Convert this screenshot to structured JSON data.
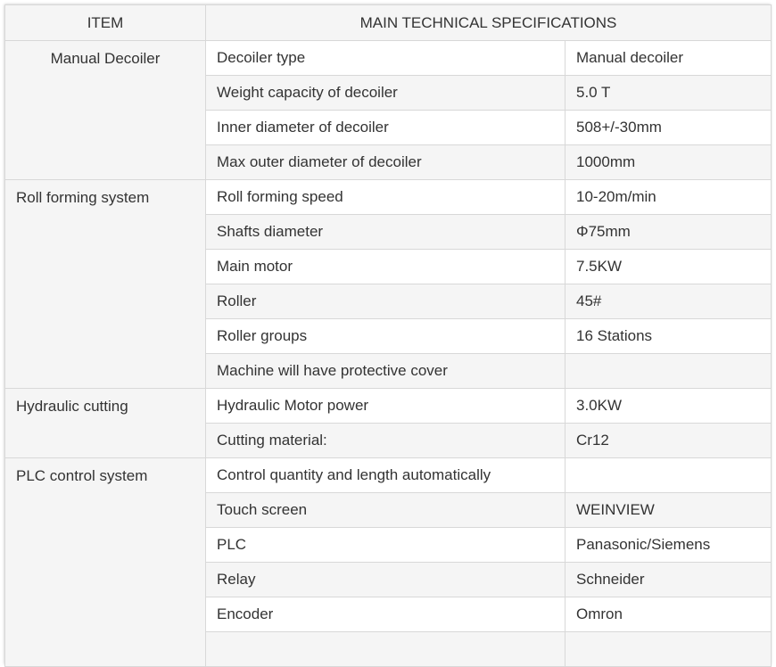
{
  "header": {
    "item": "ITEM",
    "specs": "MAIN TECHNICAL SPECIFICATIONS"
  },
  "groups": [
    {
      "item": "Manual Decoiler",
      "rows": [
        {
          "param": "Decoiler type",
          "value": "Manual decoiler"
        },
        {
          "param": "Weight capacity of decoiler",
          "value": "5.0 T"
        },
        {
          "param": "Inner diameter of decoiler",
          "value": "508+/-30mm"
        },
        {
          "param": "Max outer diameter of decoiler",
          "value": "1000mm"
        }
      ]
    },
    {
      "item": "Roll forming system",
      "rows": [
        {
          "param": "Roll forming speed",
          "value": "10-20m/min"
        },
        {
          "param": "Shafts diameter",
          "value": "Φ75mm"
        },
        {
          "param": "Main motor",
          "value": "7.5KW"
        },
        {
          "param": "Roller",
          "value": "45#"
        },
        {
          "param": "Roller groups",
          "value": "16 Stations"
        },
        {
          "param": "Machine will have protective cover",
          "value": ""
        }
      ]
    },
    {
      "item": "Hydraulic cutting",
      "rows": [
        {
          "param": "Hydraulic Motor power",
          "value": "3.0KW"
        },
        {
          "param": "Cutting material:",
          "value": "Cr12"
        }
      ]
    },
    {
      "item": "PLC control system",
      "rows": [
        {
          "param": "Control quantity and length automatically",
          "value": ""
        },
        {
          "param": "Touch screen",
          "value": "WEINVIEW"
        },
        {
          "param": "PLC",
          "value": "Panasonic/Siemens"
        },
        {
          "param": "Relay",
          "value": "Schneider"
        },
        {
          "param": "Encoder",
          "value": "Omron"
        },
        {
          "param": "",
          "value": ""
        }
      ]
    }
  ]
}
